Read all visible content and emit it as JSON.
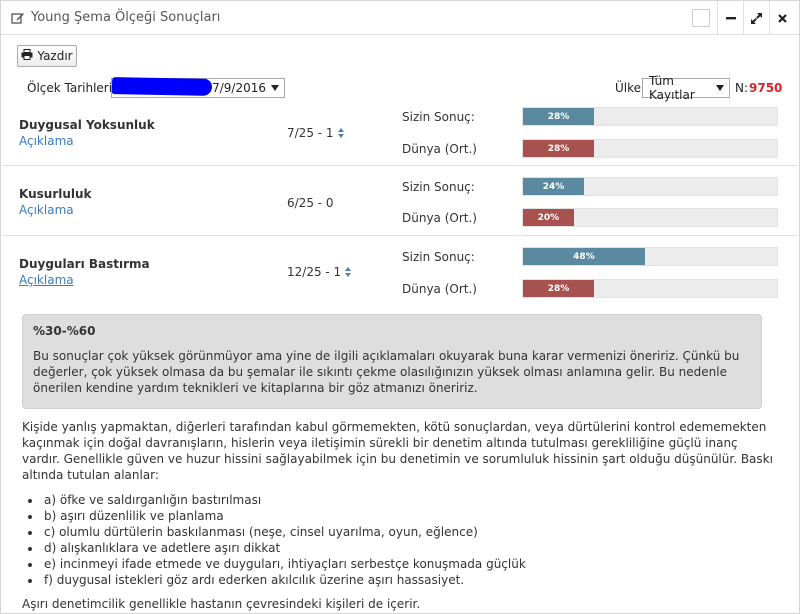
{
  "panel": {
    "title": "Young Şema Ölçeği Sonuçları"
  },
  "toolbar": {
    "print_label": "Yazdır"
  },
  "filters": {
    "date_label": "Ölçek Tarihleri :",
    "date_value": "- 7/9/2016",
    "country_label": "Ülke",
    "country_value": "Tüm Kayıtlar",
    "n_label": "N:",
    "n_value": "9750"
  },
  "labels": {
    "your_result": "Sizin Sonuç:",
    "world_avg": "Dünya (Ort.)",
    "description_link": "Açıklama"
  },
  "schemas": [
    {
      "title": "Duygusal Yoksunluk",
      "score": "7/25 - 1",
      "you_pct": 28,
      "you_label": "28%",
      "world_pct": 28,
      "world_label": "28%"
    },
    {
      "title": "Kusurluluk",
      "score": "6/25 - 0",
      "you_pct": 24,
      "you_label": "24%",
      "world_pct": 20,
      "world_label": "20%"
    },
    {
      "title": "Duyguları Bastırma",
      "score": "12/25 - 1",
      "you_pct": 48,
      "you_label": "48%",
      "world_pct": 28,
      "world_label": "28%"
    }
  ],
  "info": {
    "range": "%30-%60",
    "text": "Bu sonuçlar çok yüksek görünmüyor ama yine de ilgili açıklamaları okuyarak buna karar vermenizi öneririz. Çünkü bu değerler, çok yüksek olmasa da bu şemalar ile sıkıntı çekme olasılığınızın yüksek olması anlamına gelir. Bu nedenle önerilen kendine yardım teknikleri ve kitaplarına bir göz atmanızı öneririz."
  },
  "description": {
    "intro": "Kişide yanlış yapmaktan, diğerleri tarafından kabul görmemekten, kötü sonuçlardan, veya dürtülerini kontrol edememekten kaçınmak için doğal davranışların, hislerin veya iletişimin sürekli bir denetim altında tutulması gerekliliğine güçlü inanç vardır. Genellikle güven ve huzur hissini sağlayabilmek için bu denetimin ve sorumluluk hissinin şart olduğu düşünülür. Baskı altında tutulan alanlar:",
    "items": [
      "a) öfke ve saldırganlığın bastırılması",
      "b) aşırı düzenlilik ve planlama",
      "c) olumlu dürtülerin baskılanması (neşe, cinsel uyarılma, oyun, eğlence)",
      "d) alışkanlıklara ve adetlere aşırı dikkat",
      "e) incinmeyi ifade etmede ve duyguları, ihtiyaçları serbestçe konuşmada güçlük",
      "f) duygusal istekleri göz ardı ederken akılcılık üzerine aşırı hassasiyet."
    ],
    "outro": "Aşırı denetimcilik genellikle hastanın çevresindeki kişileri de içerir."
  },
  "colors": {
    "your_bar": "#5b8aa0",
    "world_bar": "#a85250",
    "count": "#d9232d",
    "link": "#3a7bbf"
  }
}
